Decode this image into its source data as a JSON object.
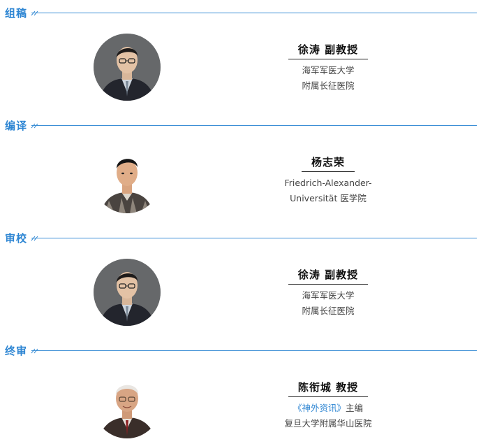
{
  "sections": [
    {
      "title": "组稿",
      "name": "徐涛 副教授",
      "affil_line1": "海军军医大学",
      "affil_line2": "附属长征医院",
      "avatar_icon": "person-photo-icon"
    },
    {
      "title": "编译",
      "name": "杨志荣",
      "affil_line1": "Friedrich-Alexander-",
      "affil_line2": "Universität 医学院",
      "avatar_icon": "person-photo-icon"
    },
    {
      "title": "审校",
      "name": "徐涛 副教授",
      "affil_line1": "海军军医大学",
      "affil_line2": "附属长征医院",
      "avatar_icon": "person-photo-icon"
    },
    {
      "title": "终审",
      "name": "陈衔城 教授",
      "affil_link": "《神外资讯》",
      "affil_link_suffix": "主编",
      "affil_line2": "复旦大学附属华山医院",
      "avatar_icon": "person-photo-icon"
    }
  ],
  "colors": {
    "accent": "#2e86d3",
    "line": "#3c8fd6"
  }
}
